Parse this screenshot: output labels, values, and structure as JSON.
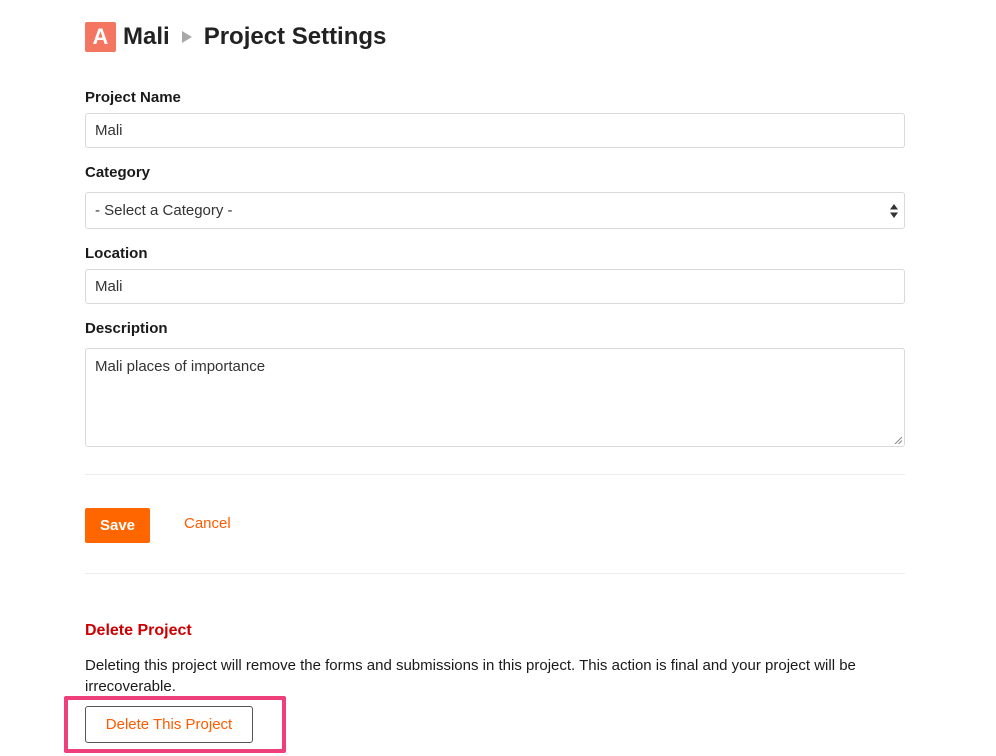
{
  "header": {
    "badge_letter": "A",
    "project_name": "Mali",
    "separator_icon": "triangle-right-icon",
    "page_title": "Project Settings"
  },
  "form": {
    "project_name": {
      "label": "Project Name",
      "value": "Mali"
    },
    "category": {
      "label": "Category",
      "selected": "- Select a Category -"
    },
    "location": {
      "label": "Location",
      "value": "Mali"
    },
    "description": {
      "label": "Description",
      "value": "Mali places of importance"
    },
    "save_label": "Save",
    "cancel_label": "Cancel"
  },
  "danger_zone": {
    "title": "Delete Project",
    "text": "Deleting this project will remove the forms and submissions in this project. This action is final and your project will be irrecoverable.",
    "delete_label": "Delete This Project"
  },
  "colors": {
    "accent": "#ff6600",
    "badge": "#f47560",
    "danger": "#cc0000",
    "highlight": "#ee3f7a"
  }
}
